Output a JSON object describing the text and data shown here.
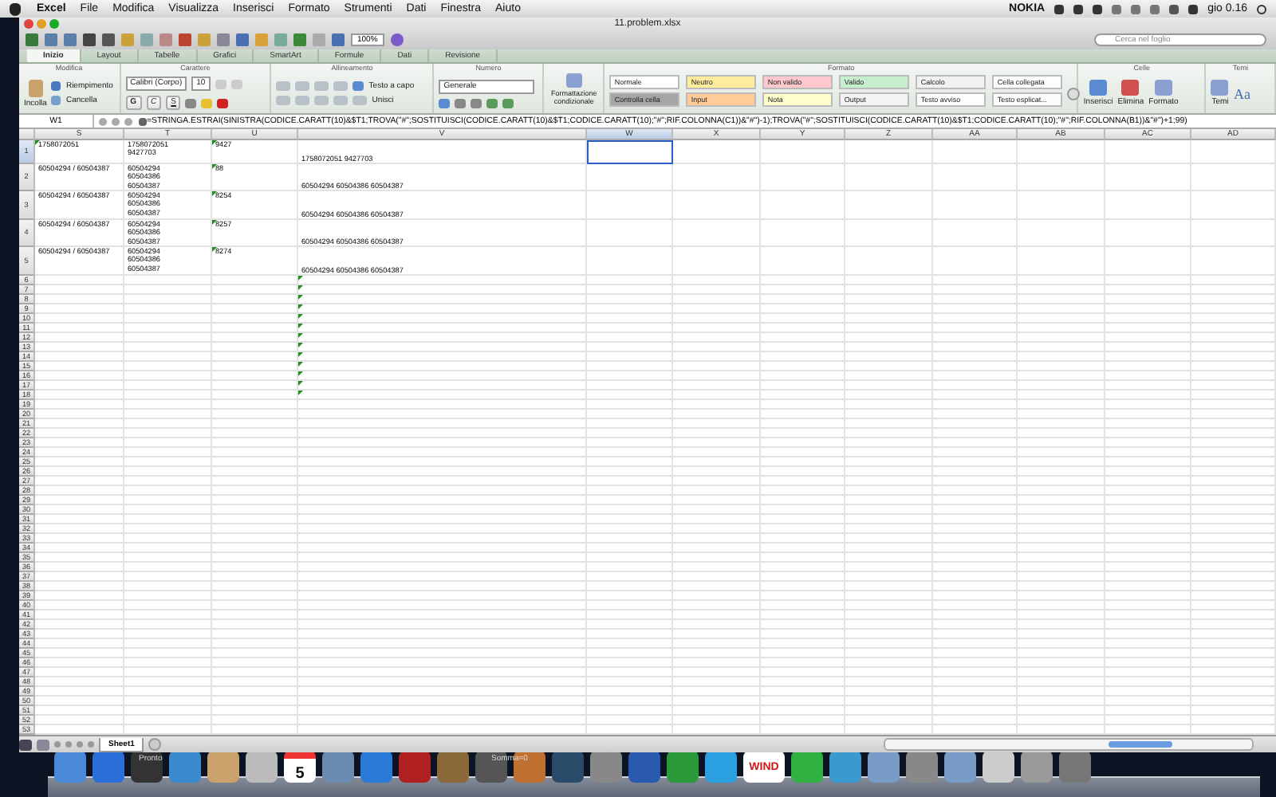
{
  "menu_bar": {
    "items": [
      "Excel",
      "File",
      "Modifica",
      "Visualizza",
      "Inserisci",
      "Formato",
      "Strumenti",
      "Dati",
      "Finestra",
      "Aiuto"
    ],
    "carrier": "NOKIA",
    "clock": "gio 0.16"
  },
  "window": {
    "title": "11.problem.xlsx",
    "zoom": "100%",
    "search": {
      "placeholder": "Cerca nel foglio"
    }
  },
  "tabs": [
    {
      "label": "Inizio",
      "selected": true
    },
    {
      "label": "Layout",
      "selected": false
    },
    {
      "label": "Tabelle",
      "selected": false
    },
    {
      "label": "Grafici",
      "selected": false
    },
    {
      "label": "SmartArt",
      "selected": false
    },
    {
      "label": "Formule",
      "selected": false
    },
    {
      "label": "Dati",
      "selected": false
    },
    {
      "label": "Revisione",
      "selected": false
    }
  ],
  "ribbon": {
    "edit": {
      "title": "Modifica",
      "paste": "Incolla",
      "fill": "Riempimento",
      "clear": "Cancella"
    },
    "font": {
      "title": "Carattere",
      "name": "Calibri (Corpo)",
      "size": "10",
      "bold": "G",
      "italic": "C",
      "underline": "S"
    },
    "alignment": {
      "title": "Allineamento",
      "wrap": "Testo a capo",
      "merge": "Unisci"
    },
    "number": {
      "title": "Numero",
      "format": "Generale"
    },
    "conditional": "Formattazione condizionale",
    "styles": {
      "title": "Formato",
      "items": [
        {
          "label": "Normale",
          "color": "#ffffff"
        },
        {
          "label": "Neutro",
          "color": "#ffeb9c"
        },
        {
          "label": "Non valido",
          "color": "#ffc7ce"
        },
        {
          "label": "Valido",
          "color": "#c6efce"
        },
        {
          "label": "Calcolo",
          "color": "#f2f2f2"
        },
        {
          "label": "Cella collegata",
          "color": "#fefefe"
        },
        {
          "label": "Controlla cella",
          "color": "#a5a5a5"
        },
        {
          "label": "Input",
          "color": "#ffcc99"
        },
        {
          "label": "Nota",
          "color": "#ffffcc"
        },
        {
          "label": "Output",
          "color": "#f3f3f3"
        },
        {
          "label": "Testo avviso",
          "color": "#fdfdfd"
        },
        {
          "label": "Testo esplicat...",
          "color": "#fcfcfc"
        }
      ]
    },
    "cells": {
      "title": "Celle",
      "insert": "Inserisci",
      "delete": "Elimina",
      "format": "Formato"
    },
    "themes": {
      "title": "Temi",
      "themes": "Temi",
      "fonts": "Aa"
    }
  },
  "formula_bar": {
    "name_box": "W1",
    "formula": "=STRINGA.ESTRAI(SINISTRA(CODICE.CARATT(10)&$T1;TROVA(\"#\";SOSTITUISCI(CODICE.CARATT(10)&$T1;CODICE.CARATT(10);\"#\";RIF.COLONNA(C1))&\"#\")-1);TROVA(\"#\";SOSTITUISCI(CODICE.CARATT(10)&$T1;CODICE.CARATT(10);\"#\";RIF.COLONNA(B1))&\"#\")+1;99)"
  },
  "grid": {
    "columns": [
      {
        "label": "S",
        "selected": false
      },
      {
        "label": "T",
        "selected": false
      },
      {
        "label": "U",
        "selected": false
      },
      {
        "label": "V",
        "selected": false
      },
      {
        "label": "W",
        "selected": true
      },
      {
        "label": "X",
        "selected": false
      },
      {
        "label": "Y",
        "selected": false
      },
      {
        "label": "Z",
        "selected": false
      },
      {
        "label": "AA",
        "selected": false
      },
      {
        "label": "AB",
        "selected": false
      },
      {
        "label": "AC",
        "selected": false
      },
      {
        "label": "AD",
        "selected": false
      }
    ],
    "rows": [
      {
        "number": "1",
        "selected": true,
        "cells": [
          {
            "text": "1758072051",
            "flag": true
          },
          {
            "text": "1758072051\n9427703",
            "flag": false
          },
          {
            "text": "9427",
            "flag": true
          },
          {
            "text": "1758072051 9427703",
            "flag": false
          }
        ]
      },
      {
        "number": "2",
        "selected": false,
        "cells": [
          {
            "text": "60504294 / 60504387",
            "flag": false
          },
          {
            "text": "60504294\n60504386\n60504387",
            "flag": false
          },
          {
            "text": "88",
            "flag": true
          },
          {
            "text": "60504294 60504386 60504387",
            "flag": false
          }
        ]
      },
      {
        "number": "3",
        "selected": false,
        "cells": [
          {
            "text": "60504294 / 60504387",
            "flag": false
          },
          {
            "text": "60504294\n60504386\n60504387",
            "flag": false
          },
          {
            "text": "8254",
            "flag": true
          },
          {
            "text": "60504294 60504386 60504387",
            "flag": false
          }
        ]
      },
      {
        "number": "4",
        "selected": false,
        "cells": [
          {
            "text": "60504294 / 60504387",
            "flag": false
          },
          {
            "text": "60504294\n60504386\n60504387",
            "flag": false
          },
          {
            "text": "8257",
            "flag": true
          },
          {
            "text": "60504294 60504386 60504387",
            "flag": false
          }
        ]
      },
      {
        "number": "5",
        "selected": false,
        "cells": [
          {
            "text": "60504294 / 60504387",
            "flag": false
          },
          {
            "text": "60504294\n60504386\n60504387",
            "flag": false
          },
          {
            "text": "8274",
            "flag": true
          },
          {
            "text": "60504294 60504386 60504387",
            "flag": false
          }
        ]
      },
      {
        "number": "6",
        "flagged": true
      },
      {
        "number": "7",
        "flagged": true
      },
      {
        "number": "8",
        "flagged": true
      },
      {
        "number": "9",
        "flagged": true
      },
      {
        "number": "10",
        "flagged": true
      },
      {
        "number": "11",
        "flagged": true
      },
      {
        "number": "12",
        "flagged": true
      },
      {
        "number": "13",
        "flagged": true
      },
      {
        "number": "14",
        "flagged": true
      },
      {
        "number": "15",
        "flagged": true
      },
      {
        "number": "16",
        "flagged": true
      },
      {
        "number": "17",
        "flagged": true
      },
      {
        "number": "18",
        "flagged": true
      },
      {
        "number": "19",
        "flagged": false
      },
      {
        "number": "20",
        "flagged": false
      },
      {
        "number": "21",
        "flagged": false
      },
      {
        "number": "22",
        "flagged": false
      },
      {
        "number": "23",
        "flagged": false
      },
      {
        "number": "24",
        "flagged": false
      },
      {
        "number": "25",
        "flagged": false
      },
      {
        "number": "26",
        "flagged": false
      },
      {
        "number": "27",
        "flagged": false
      },
      {
        "number": "28",
        "flagged": false
      },
      {
        "number": "29",
        "flagged": false
      },
      {
        "number": "30",
        "flagged": false
      },
      {
        "number": "31",
        "flagged": false
      },
      {
        "number": "32",
        "flagged": false
      },
      {
        "number": "33",
        "flagged": false
      },
      {
        "number": "34",
        "flagged": false
      },
      {
        "number": "35",
        "flagged": false
      },
      {
        "number": "36",
        "flagged": false
      },
      {
        "number": "37",
        "flagged": false
      },
      {
        "number": "38",
        "flagged": false
      },
      {
        "number": "39",
        "flagged": false
      },
      {
        "number": "40",
        "flagged": false
      },
      {
        "number": "41",
        "flagged": false
      },
      {
        "number": "42",
        "flagged": false
      },
      {
        "number": "43",
        "flagged": false
      },
      {
        "number": "44",
        "flagged": false
      },
      {
        "number": "45",
        "flagged": false
      },
      {
        "number": "46",
        "flagged": false
      },
      {
        "number": "47",
        "flagged": false
      },
      {
        "number": "48",
        "flagged": false
      },
      {
        "number": "49",
        "flagged": false
      },
      {
        "number": "50",
        "flagged": false
      },
      {
        "number": "51",
        "flagged": false
      },
      {
        "number": "52",
        "flagged": false
      },
      {
        "number": "53",
        "flagged": false
      }
    ]
  },
  "sheet_bar": {
    "sheets": [
      {
        "label": "Sheet1",
        "selected": true
      }
    ],
    "status": "Pronto",
    "sum": "Somma=0"
  },
  "dock": {
    "calendar_day": "5",
    "wind_label": "WIND"
  }
}
